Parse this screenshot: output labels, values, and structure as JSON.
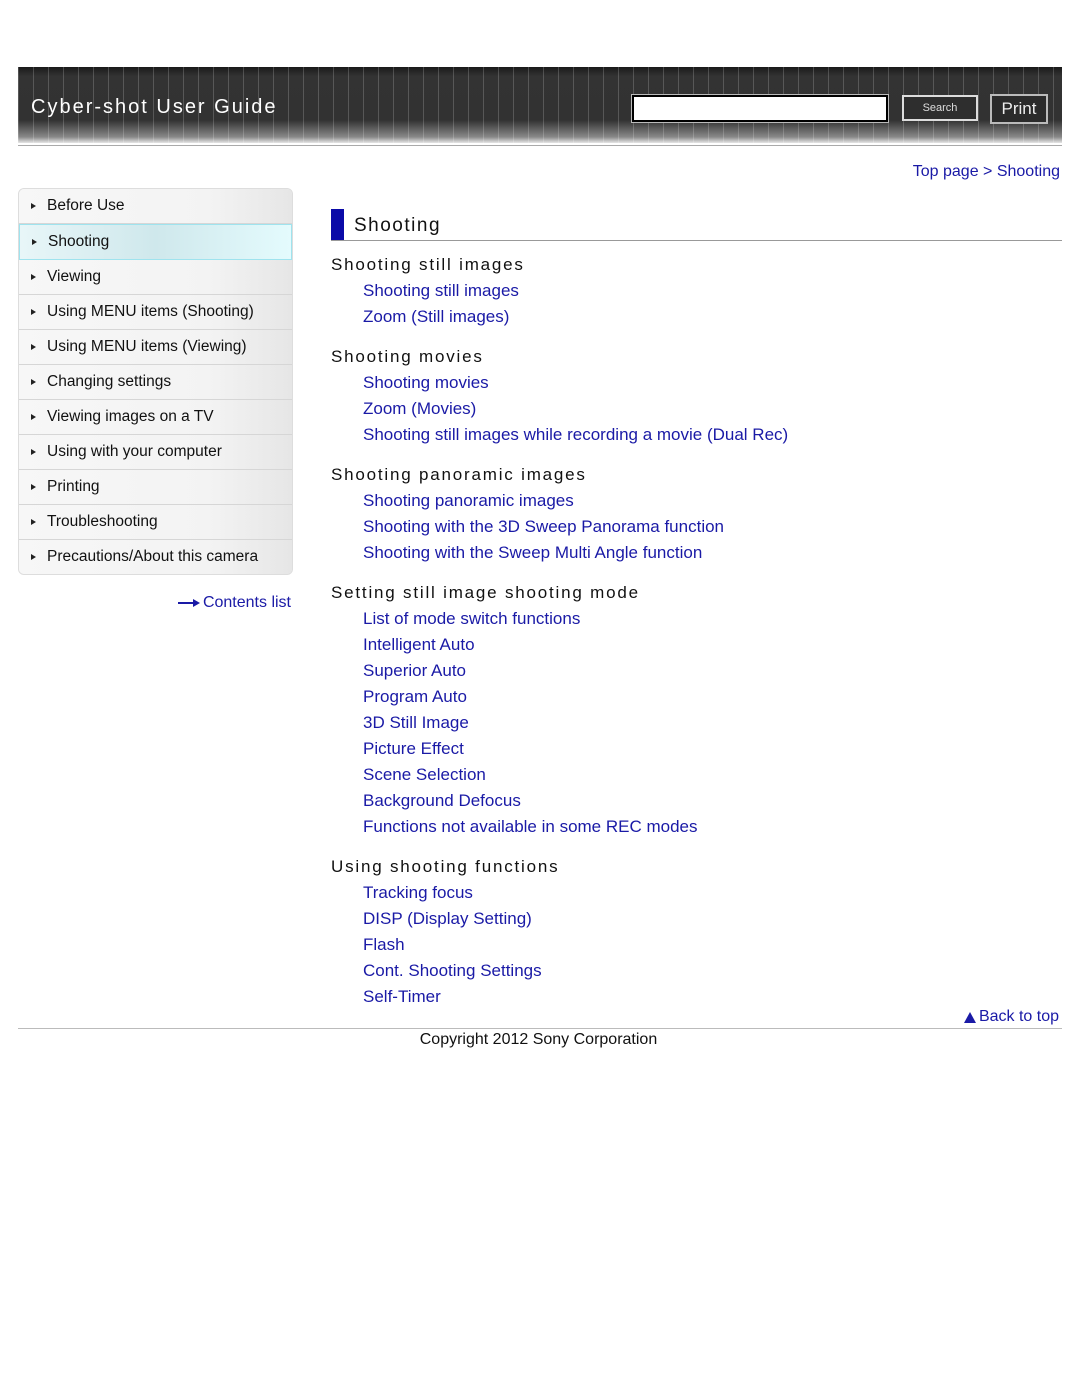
{
  "header": {
    "app_title": "Cyber-shot User Guide",
    "search_placeholder": "",
    "search_value": "",
    "search_button": "Search",
    "print_button": "Print"
  },
  "breadcrumb": {
    "top": "Top page",
    "separator": " > ",
    "current": "Shooting"
  },
  "sidebar": {
    "items": [
      {
        "label": "Before Use"
      },
      {
        "label": "Shooting",
        "active": true
      },
      {
        "label": "Viewing"
      },
      {
        "label": "Using MENU items (Shooting)"
      },
      {
        "label": "Using MENU items (Viewing)"
      },
      {
        "label": "Changing settings"
      },
      {
        "label": "Viewing images on a TV"
      },
      {
        "label": "Using with your computer"
      },
      {
        "label": "Printing"
      },
      {
        "label": "Troubleshooting"
      },
      {
        "label": "Precautions/About this camera"
      }
    ],
    "contents_link": "Contents list",
    "contents_icon": "arrow-right-icon"
  },
  "main": {
    "title": "Shooting",
    "sections": [
      {
        "heading": "Shooting still images",
        "links": [
          "Shooting still images",
          "Zoom (Still images)"
        ]
      },
      {
        "heading": "Shooting movies",
        "links": [
          "Shooting movies",
          "Zoom (Movies)",
          "Shooting still images while recording a movie (Dual Rec)"
        ]
      },
      {
        "heading": "Shooting panoramic images",
        "links": [
          "Shooting panoramic images",
          "Shooting with the 3D Sweep Panorama function",
          "Shooting with the Sweep Multi Angle function"
        ]
      },
      {
        "heading": "Setting still image shooting mode",
        "links": [
          "List of mode switch functions",
          "Intelligent Auto",
          "Superior Auto",
          "Program Auto",
          "3D Still Image",
          "Picture Effect",
          "Scene Selection",
          "Background Defocus",
          "Functions not available in some REC modes"
        ]
      },
      {
        "heading": "Using shooting functions",
        "links": [
          "Tracking focus",
          "DISP (Display Setting)",
          "Flash",
          "Cont. Shooting Settings",
          "Self-Timer"
        ]
      }
    ]
  },
  "footer": {
    "back_to_top": "Back to top",
    "back_to_top_icon": "triangle-up-icon",
    "copyright": "Copyright 2012 Sony Corporation"
  },
  "colors": {
    "link": "#1a1aa6",
    "title_mark": "#0a0aa8",
    "active_item": "#cfe8ec"
  }
}
